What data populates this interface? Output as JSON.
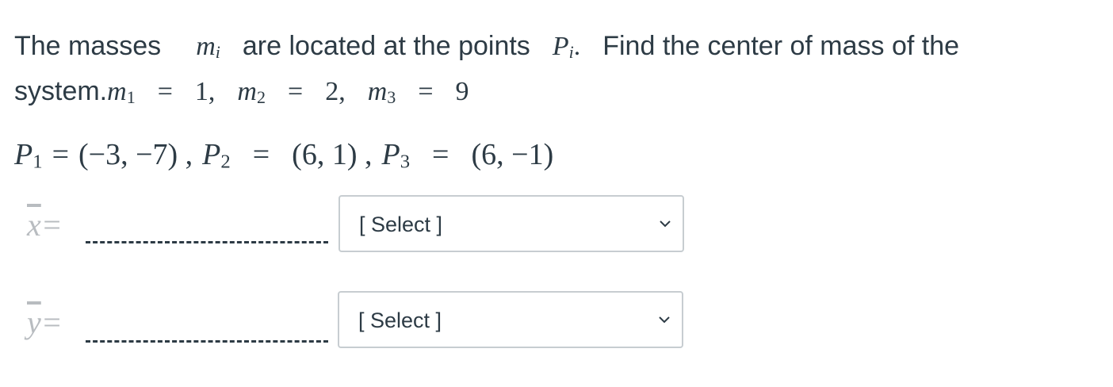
{
  "question": {
    "intro_before_mi": "The masses",
    "intro_mi_letter": "m",
    "intro_mi_sub": "i",
    "intro_middle": "are located at the points",
    "intro_pi_letter": "P",
    "intro_pi_sub": "i",
    "intro_pi_dot": ".",
    "intro_after": "Find the center of mass of the",
    "line2_prefix": "system.",
    "masses": [
      {
        "letter": "m",
        "sub": "1",
        "value": "1,"
      },
      {
        "letter": "m",
        "sub": "2",
        "value": "2,"
      },
      {
        "letter": "m",
        "sub": "3",
        "value": "9"
      }
    ],
    "equals": "=",
    "points": [
      {
        "letter": "P",
        "sub": "1",
        "value": "(−3, −7) ,"
      },
      {
        "letter": "P",
        "sub": "2",
        "value": "(6, 1) ,"
      },
      {
        "letter": "P",
        "sub": "3",
        "value": "(6, −1)"
      }
    ]
  },
  "answers": [
    {
      "var": "x",
      "suffix": "=",
      "select_label": "[ Select ]"
    },
    {
      "var": "y",
      "suffix": "=",
      "select_label": "[ Select ]"
    }
  ],
  "icons": {
    "dropdown": "chevron-down-icon"
  }
}
